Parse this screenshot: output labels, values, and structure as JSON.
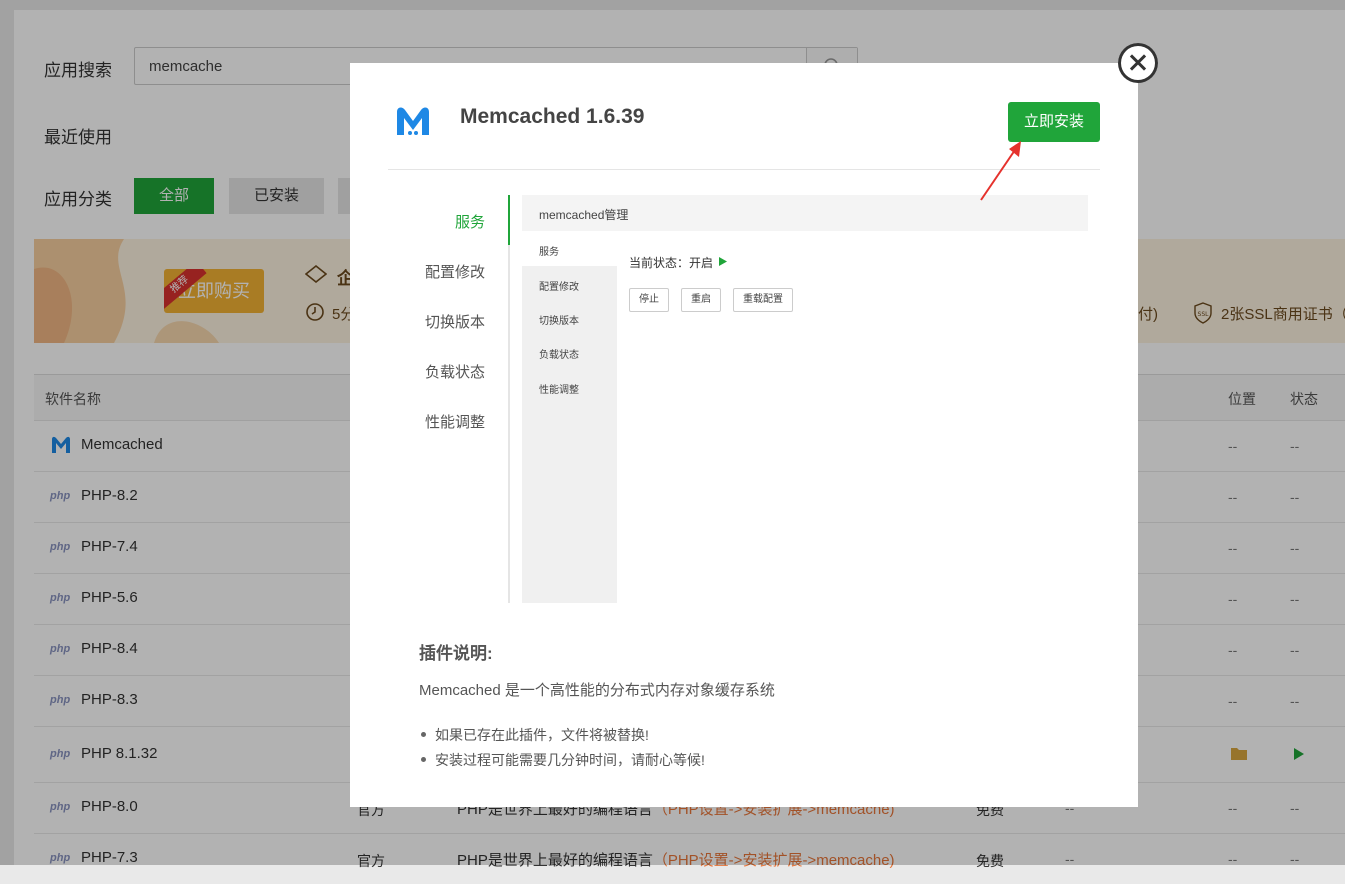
{
  "page": {
    "search_label": "应用搜索",
    "search_value": "memcache",
    "recent_label": "最近使用",
    "category_label": "应用分类",
    "categories": [
      "全部",
      "已安装"
    ],
    "banner": {
      "buy_label": "立即购买",
      "ribbon": "推荐",
      "text_left_1": "企",
      "text_left_2": "5分",
      "text_right_1": "付)",
      "text_right_2": "2张SSL商用证书（"
    },
    "table": {
      "headers": [
        "软件名称",
        "位置",
        "状态"
      ],
      "rows": [
        {
          "name": "Memcached",
          "type": "",
          "desc": "",
          "desc_link": "",
          "price": "",
          "expire": "",
          "position": "--",
          "status": "--"
        },
        {
          "name": "PHP-8.2",
          "type": "",
          "desc": "",
          "desc_link": "",
          "price": "",
          "expire": "",
          "position": "--",
          "status": "--"
        },
        {
          "name": "PHP-7.4",
          "type": "",
          "desc": "",
          "desc_link": "",
          "price": "",
          "expire": "",
          "position": "--",
          "status": "--"
        },
        {
          "name": "PHP-5.6",
          "type": "",
          "desc": "",
          "desc_link": "",
          "price": "",
          "expire": "",
          "position": "--",
          "status": "--"
        },
        {
          "name": "PHP-8.4",
          "type": "",
          "desc": "",
          "desc_link": "",
          "price": "",
          "expire": "",
          "position": "--",
          "status": "--"
        },
        {
          "name": "PHP-8.3",
          "type": "",
          "desc": "",
          "desc_link": "",
          "price": "",
          "expire": "",
          "position": "--",
          "status": "--"
        },
        {
          "name": "PHP 8.1.32",
          "type": "",
          "desc": "",
          "desc_link": "",
          "price": "",
          "expire": "",
          "position": "",
          "status": ""
        },
        {
          "name": "PHP-8.0",
          "type": "官方",
          "desc": "PHP是世界上最好的编程语言",
          "desc_link": "（PHP设置->安装扩展->memcache)",
          "price": "免费",
          "expire": "--",
          "position": "--",
          "status": "--"
        },
        {
          "name": "PHP-7.3",
          "type": "官方",
          "desc": "PHP是世界上最好的编程语言",
          "desc_link": "（PHP设置->安装扩展->memcache)",
          "price": "免费",
          "expire": "--",
          "position": "--",
          "status": "--"
        }
      ]
    }
  },
  "modal": {
    "title": "Memcached 1.6.39",
    "install_label": "立即安装",
    "side_menu": [
      "服务",
      "配置修改",
      "切换版本",
      "负载状态",
      "性能调整"
    ],
    "preview": {
      "header": "memcached管理",
      "menu": [
        "服务",
        "配置修改",
        "切换版本",
        "负载状态",
        "性能调整"
      ],
      "status_text": "当前状态：开启",
      "buttons": [
        "停止",
        "重启",
        "重载配置"
      ]
    },
    "desc_title": "插件说明:",
    "desc": "Memcached 是一个高性能的分布式内存对象缓存系统",
    "notes": [
      "如果已存在此插件，文件将被替换!",
      "安装过程可能需要几分钟时间，请耐心等候!"
    ]
  },
  "colors": {
    "primary_green": "#20a53a",
    "link_orange": "#e8763a",
    "memcached_blue": "#1e88e5",
    "banner_gold": "#f3b234",
    "annotation_red": "#e5322d"
  }
}
